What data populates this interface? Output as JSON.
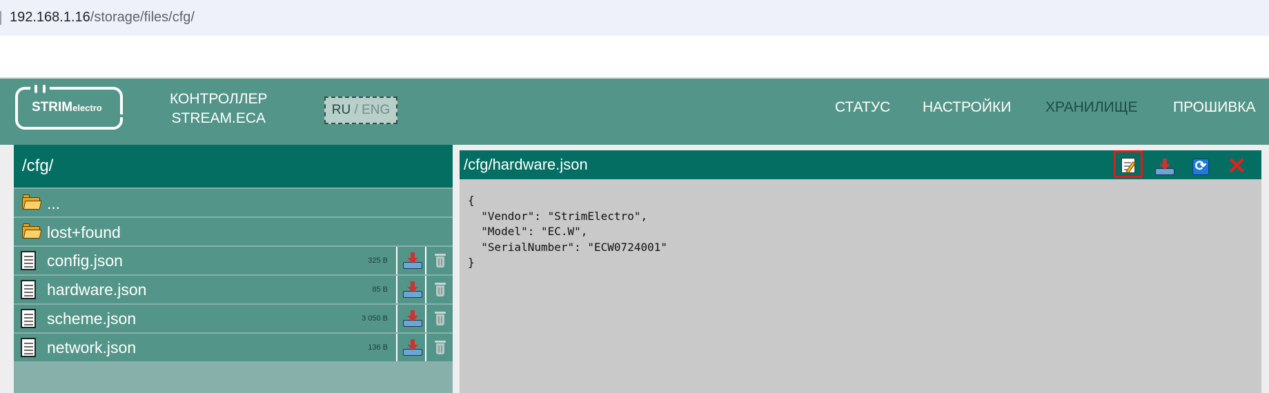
{
  "browser": {
    "url_host": "192.168.1.16",
    "url_path": "/storage/files/cfg/"
  },
  "header": {
    "logo_strim": "STRIM",
    "logo_electro": "electro",
    "title_line1": "КОНТРОЛЛЕР",
    "title_line2": "STREAM.ECA",
    "lang_ru": "RU",
    "lang_sep": " / ",
    "lang_eng": "ENG",
    "nav": [
      {
        "label": "СТАТУС"
      },
      {
        "label": "НАСТРОЙКИ"
      },
      {
        "label": "ХРАНИЛИЩЕ"
      },
      {
        "label": "ПРОШИВКА"
      }
    ],
    "active_nav": "ХРАНИЛИЩЕ"
  },
  "browser_panel": {
    "current_dir": "/cfg/",
    "dirs": [
      {
        "name": "..."
      },
      {
        "name": "lost+found"
      }
    ],
    "files": [
      {
        "name": "config.json",
        "size": "325 B"
      },
      {
        "name": "hardware.json",
        "size": "85 B"
      },
      {
        "name": "scheme.json",
        "size": "3 050 B"
      },
      {
        "name": "network.json",
        "size": "136 B"
      }
    ]
  },
  "viewer": {
    "path": "/cfg/hardware.json",
    "toolbar": [
      "edit-icon",
      "download-icon",
      "refresh-icon",
      "close-icon"
    ],
    "highlighted_button": "edit",
    "content": "{\n  \"Vendor\": \"StrimElectro\",\n  \"Model\": \"EC.W\",\n  \"SerialNumber\": \"ECW0724001\"\n}"
  },
  "colors": {
    "header_bg": "#549589",
    "panel_head": "#046e63",
    "row_bg": "#549589",
    "viewer_bg": "#c9c9c9",
    "highlight": "#e01b1b"
  }
}
